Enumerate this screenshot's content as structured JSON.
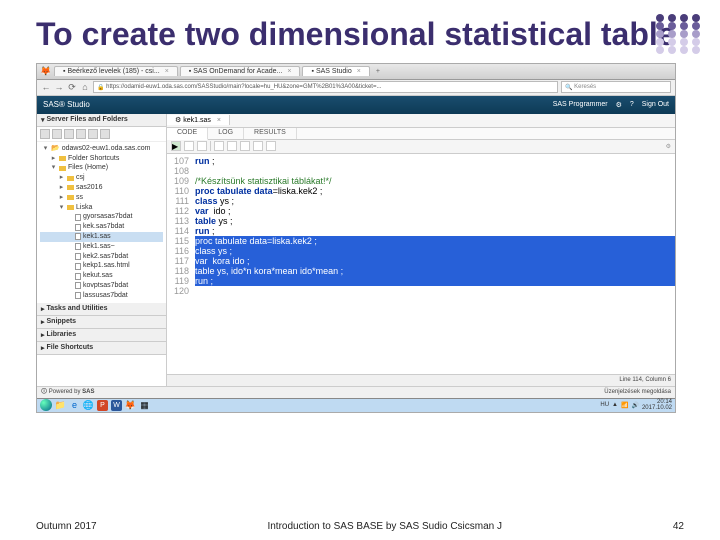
{
  "slide": {
    "title": "To create two dimensional statistical table",
    "footer_left": "Outumn 2017",
    "footer_mid": "Introduction to SAS BASE by SAS Sudio Csicsman J",
    "footer_right": "42"
  },
  "browser": {
    "tabs": [
      {
        "label": "Beérkező levelek (185) - csi...",
        "icon": "mail"
      },
      {
        "label": "SAS OnDemand for Acade...",
        "icon": "sas"
      },
      {
        "label": "SAS Studio",
        "icon": "sas",
        "active": true
      }
    ],
    "nav": {
      "back": "←",
      "fwd": "→",
      "reload": "⟳",
      "home": "⌂"
    },
    "address": "https://odamid-euw1.oda.sas.com/SASStudio/main?locale=hu_HU&zone=GMT%2B01%3A00&ticket=...",
    "search_placeholder": "Keresés"
  },
  "app": {
    "title": "SAS® Studio",
    "rightItems": [
      "SAS Programmer",
      "⚙",
      "?",
      "Sign Out"
    ]
  },
  "sidebar": {
    "header": "Server Files and Folders",
    "root": "odaws02-euw1.oda.sas.com",
    "items": [
      {
        "label": "Folder Shortcuts",
        "type": "folder",
        "ind": 1,
        "exp": "▸"
      },
      {
        "label": "Files (Home)",
        "type": "folder",
        "ind": 1,
        "exp": "▾"
      },
      {
        "label": "csj",
        "type": "folder",
        "ind": 2,
        "exp": "▸"
      },
      {
        "label": "sas2016",
        "type": "folder",
        "ind": 2,
        "exp": "▸"
      },
      {
        "label": "ss",
        "type": "folder",
        "ind": 2,
        "exp": "▸"
      },
      {
        "label": "Liska",
        "type": "folder",
        "ind": 2,
        "exp": "▾"
      },
      {
        "label": "gyorsasas7bdat",
        "type": "file",
        "ind": 3
      },
      {
        "label": "kek.sas7bdat",
        "type": "file",
        "ind": 3
      },
      {
        "label": "kek1.sas",
        "type": "file",
        "ind": 3,
        "sel": true
      },
      {
        "label": "kek1.sas~",
        "type": "file",
        "ind": 3
      },
      {
        "label": "kek2.sas7bdat",
        "type": "file",
        "ind": 3
      },
      {
        "label": "kekp1.sas.html",
        "type": "file",
        "ind": 3
      },
      {
        "label": "kekut.sas",
        "type": "file",
        "ind": 3
      },
      {
        "label": "kovptsas7bdat",
        "type": "file",
        "ind": 3
      },
      {
        "label": "lassusas7bdat",
        "type": "file",
        "ind": 3
      }
    ],
    "sections": [
      "Tasks and Utilities",
      "Snippets",
      "Libraries",
      "File Shortcuts"
    ]
  },
  "editor": {
    "tab": "kek1.sas",
    "subtabs": [
      "CODE",
      "LOG",
      "RESULTS"
    ],
    "active_sub": "CODE",
    "lines": [
      {
        "n": 107,
        "text": "run ;",
        "kw": [
          "run"
        ]
      },
      {
        "n": 108,
        "text": ""
      },
      {
        "n": 109,
        "text": "/*Készítsünk statisztikai táblákat!*/",
        "cm": true
      },
      {
        "n": 110,
        "text": "proc tabulate data=liska.kek2 ;",
        "kw": [
          "proc",
          "tabulate",
          "data"
        ]
      },
      {
        "n": 111,
        "text": "class ys ;",
        "kw": [
          "class"
        ]
      },
      {
        "n": 112,
        "text": "var  ido ;",
        "kw": [
          "var"
        ]
      },
      {
        "n": 113,
        "text": "table ys ;",
        "kw": [
          "table"
        ]
      },
      {
        "n": 114,
        "text": "run ;",
        "kw": [
          "run"
        ]
      },
      {
        "n": 115,
        "text": "proc tabulate data=liska.kek2 ;",
        "hl": true
      },
      {
        "n": 116,
        "text": "class ys ;",
        "hl": true
      },
      {
        "n": 117,
        "text": "var  kora ido ;",
        "hl": true
      },
      {
        "n": 118,
        "text": "table ys, ido*n kora*mean ido*mean ;",
        "hl": true
      },
      {
        "n": 119,
        "text": "run ;",
        "hl": true
      },
      {
        "n": 120,
        "text": ""
      }
    ],
    "status_left": "",
    "status_right": "Line 114, Column 6"
  },
  "taskbar": {
    "time": "20:14",
    "date": "2017.10.02",
    "lang": "HU",
    "user": "Üzenjelzések megoldása"
  }
}
